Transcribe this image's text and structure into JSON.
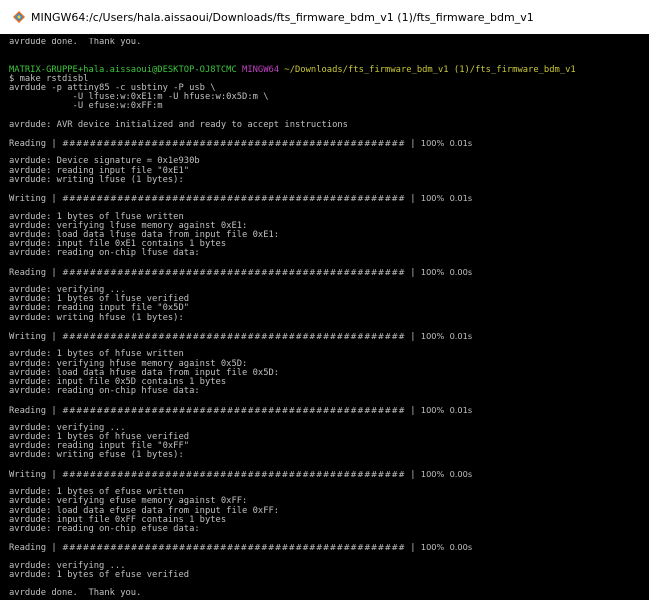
{
  "window": {
    "title": "MINGW64:/c/Users/hala.aissaoui/Downloads/fts_firmware_bdm_v1 (1)/fts_firmware_bdm_v1"
  },
  "prompt": {
    "user_host": "MATRIX-GRUPPE+hala.aissaoui@DESKTOP-OJ8TCMC",
    "shell": "MINGW64",
    "path": "~/Downloads/fts_firmware_bdm_v1 (1)/fts_firmware_bdm_v1"
  },
  "progress_bar": "##################################################",
  "lines": [
    {
      "kind": "text",
      "text": "avrdude done.  Thank you."
    },
    {
      "kind": "blank"
    },
    {
      "kind": "blank"
    },
    {
      "kind": "prompt"
    },
    {
      "kind": "text",
      "text": "$ make rstdisbl"
    },
    {
      "kind": "text",
      "text": "avrdude -p attiny85 -c usbtiny -P usb \\"
    },
    {
      "kind": "text",
      "text": "            -U lfuse:w:0xE1:m -U hfuse:w:0x5D:m \\"
    },
    {
      "kind": "text",
      "text": "            -U efuse:w:0xFF:m"
    },
    {
      "kind": "blank"
    },
    {
      "kind": "text",
      "text": "avrdude: AVR device initialized and ready to accept instructions"
    },
    {
      "kind": "blank"
    },
    {
      "kind": "progress",
      "label": "Reading",
      "percent": "100%",
      "time": "0.01s"
    },
    {
      "kind": "blank"
    },
    {
      "kind": "text",
      "text": "avrdude: Device signature = 0x1e930b"
    },
    {
      "kind": "text",
      "text": "avrdude: reading input file \"0xE1\""
    },
    {
      "kind": "text",
      "text": "avrdude: writing lfuse (1 bytes):"
    },
    {
      "kind": "blank"
    },
    {
      "kind": "progress",
      "label": "Writing",
      "percent": "100%",
      "time": "0.01s"
    },
    {
      "kind": "blank"
    },
    {
      "kind": "text",
      "text": "avrdude: 1 bytes of lfuse written"
    },
    {
      "kind": "text",
      "text": "avrdude: verifying lfuse memory against 0xE1:"
    },
    {
      "kind": "text",
      "text": "avrdude: load data lfuse data from input file 0xE1:"
    },
    {
      "kind": "text",
      "text": "avrdude: input file 0xE1 contains 1 bytes"
    },
    {
      "kind": "text",
      "text": "avrdude: reading on-chip lfuse data:"
    },
    {
      "kind": "blank"
    },
    {
      "kind": "progress",
      "label": "Reading",
      "percent": "100%",
      "time": "0.00s"
    },
    {
      "kind": "blank"
    },
    {
      "kind": "text",
      "text": "avrdude: verifying ..."
    },
    {
      "kind": "text",
      "text": "avrdude: 1 bytes of lfuse verified"
    },
    {
      "kind": "text",
      "text": "avrdude: reading input file \"0x5D\""
    },
    {
      "kind": "text",
      "text": "avrdude: writing hfuse (1 bytes):"
    },
    {
      "kind": "blank"
    },
    {
      "kind": "progress",
      "label": "Writing",
      "percent": "100%",
      "time": "0.01s"
    },
    {
      "kind": "blank"
    },
    {
      "kind": "text",
      "text": "avrdude: 1 bytes of hfuse written"
    },
    {
      "kind": "text",
      "text": "avrdude: verifying hfuse memory against 0x5D:"
    },
    {
      "kind": "text",
      "text": "avrdude: load data hfuse data from input file 0x5D:"
    },
    {
      "kind": "text",
      "text": "avrdude: input file 0x5D contains 1 bytes"
    },
    {
      "kind": "text",
      "text": "avrdude: reading on-chip hfuse data:"
    },
    {
      "kind": "blank"
    },
    {
      "kind": "progress",
      "label": "Reading",
      "percent": "100%",
      "time": "0.01s"
    },
    {
      "kind": "blank"
    },
    {
      "kind": "text",
      "text": "avrdude: verifying ..."
    },
    {
      "kind": "text",
      "text": "avrdude: 1 bytes of hfuse verified"
    },
    {
      "kind": "text",
      "text": "avrdude: reading input file \"0xFF\""
    },
    {
      "kind": "text",
      "text": "avrdude: writing efuse (1 bytes):"
    },
    {
      "kind": "blank"
    },
    {
      "kind": "progress",
      "label": "Writing",
      "percent": "100%",
      "time": "0.00s"
    },
    {
      "kind": "blank"
    },
    {
      "kind": "text",
      "text": "avrdude: 1 bytes of efuse written"
    },
    {
      "kind": "text",
      "text": "avrdude: verifying efuse memory against 0xFF:"
    },
    {
      "kind": "text",
      "text": "avrdude: load data efuse data from input file 0xFF:"
    },
    {
      "kind": "text",
      "text": "avrdude: input file 0xFF contains 1 bytes"
    },
    {
      "kind": "text",
      "text": "avrdude: reading on-chip efuse data:"
    },
    {
      "kind": "blank"
    },
    {
      "kind": "progress",
      "label": "Reading",
      "percent": "100%",
      "time": "0.00s"
    },
    {
      "kind": "blank"
    },
    {
      "kind": "text",
      "text": "avrdude: verifying ..."
    },
    {
      "kind": "text",
      "text": "avrdude: 1 bytes of efuse verified"
    },
    {
      "kind": "blank"
    },
    {
      "kind": "text",
      "text": "avrdude done.  Thank you."
    }
  ],
  "colors": {
    "background": "#000000",
    "text": "#c0c0c0",
    "prompt_user": "#3ec43e",
    "prompt_shell": "#bf40bf",
    "prompt_path": "#c8c83a"
  },
  "icons": {
    "app": "mingw-app-icon"
  }
}
